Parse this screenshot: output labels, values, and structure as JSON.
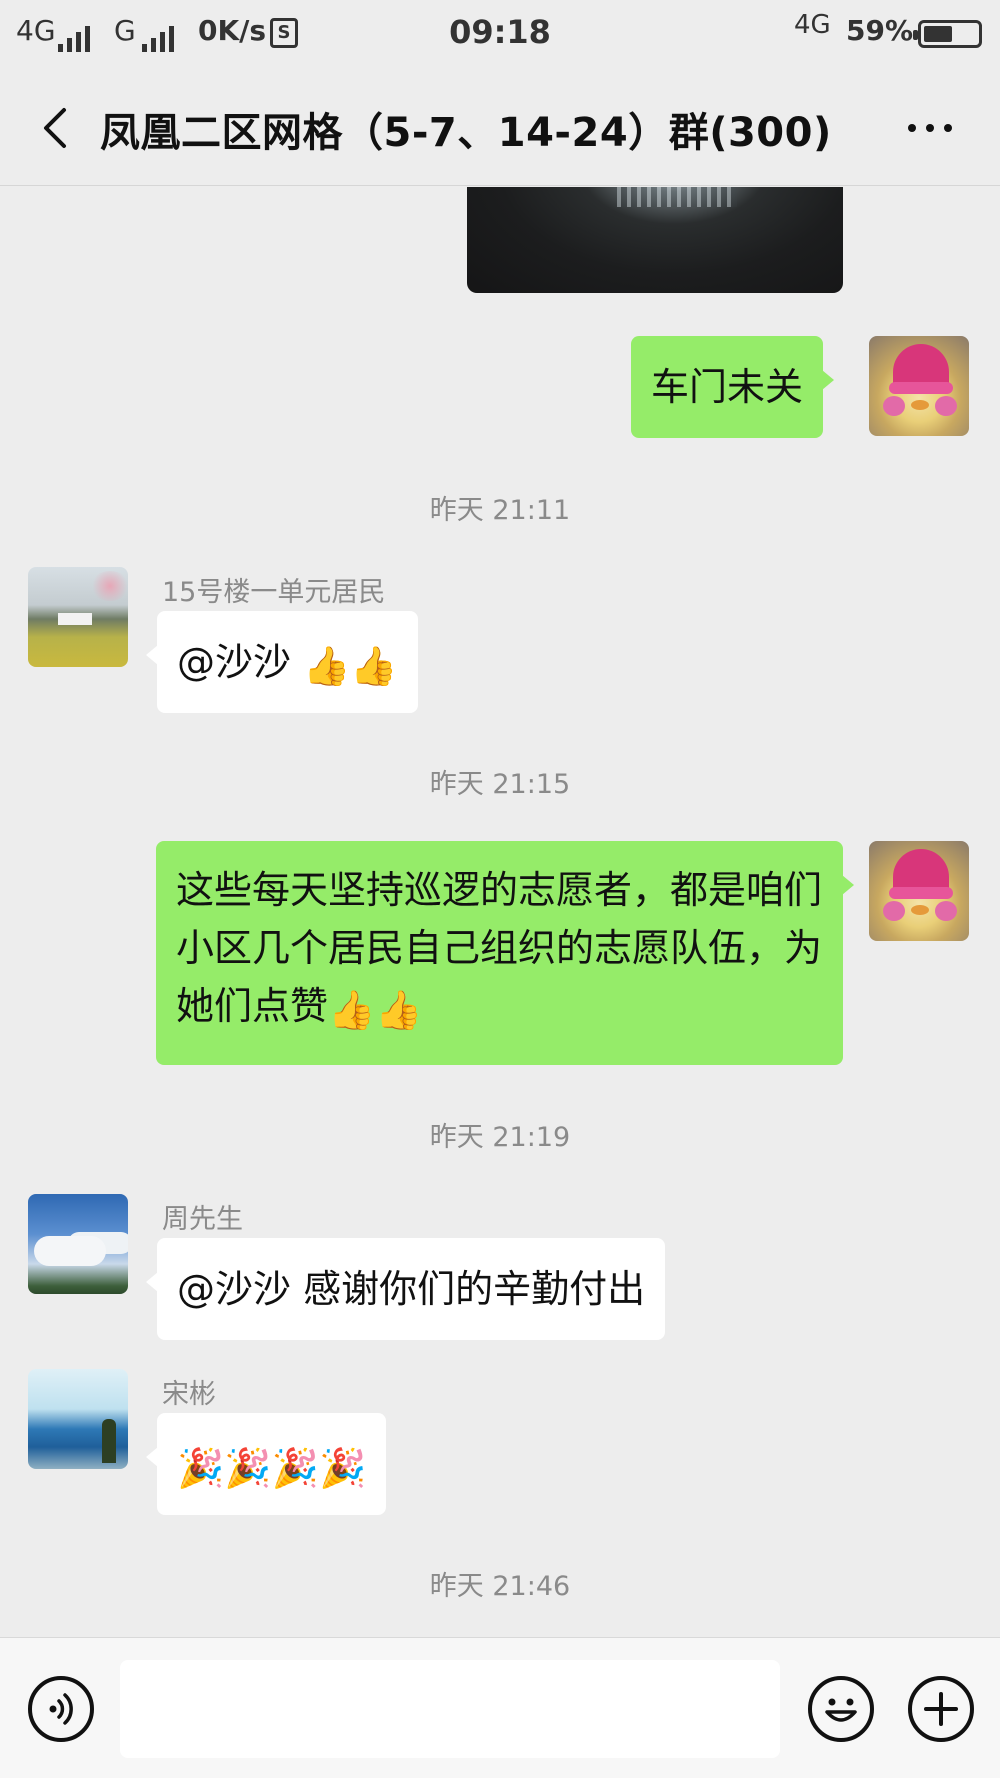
{
  "status_bar": {
    "network_left": "4G",
    "network_g": "G",
    "speed": "0K/s",
    "sim_label": "S",
    "time": "09:18",
    "network_right": "4G",
    "battery_percent": "59%",
    "battery_level": 0.59
  },
  "nav": {
    "back_icon": "chevron-left-icon",
    "title": "凤凰二区网格（5-7、14-24）群(300)",
    "more_icon": "ellipsis-icon"
  },
  "messages": [
    {
      "type": "image",
      "side": "out"
    },
    {
      "type": "text",
      "side": "out",
      "text": "车门未关"
    },
    {
      "type": "time",
      "text": "昨天 21:11"
    },
    {
      "type": "text",
      "side": "in",
      "sender": "15号楼一单元居民",
      "text": "@沙沙 ",
      "emoji": "👍👍"
    },
    {
      "type": "time",
      "text": "昨天 21:15"
    },
    {
      "type": "text",
      "side": "out",
      "text": "这些每天坚持巡逻的志愿者，都是咱们小区几个居民自己组织的志愿队伍，为她们点赞",
      "emoji": "👍👍"
    },
    {
      "type": "time",
      "text": "昨天 21:19"
    },
    {
      "type": "text",
      "side": "in",
      "sender": "周先生",
      "text": "@沙沙  感谢你们的辛勤付出"
    },
    {
      "type": "text",
      "side": "in",
      "sender": "宋彬",
      "emoji": "🎉🎉🎉🎉"
    },
    {
      "type": "time",
      "text": "昨天 21:46"
    }
  ],
  "input_bar": {
    "voice_icon": "voice-icon",
    "input_value": "",
    "emoji_icon": "smiley-icon",
    "plus_icon": "plus-icon"
  }
}
